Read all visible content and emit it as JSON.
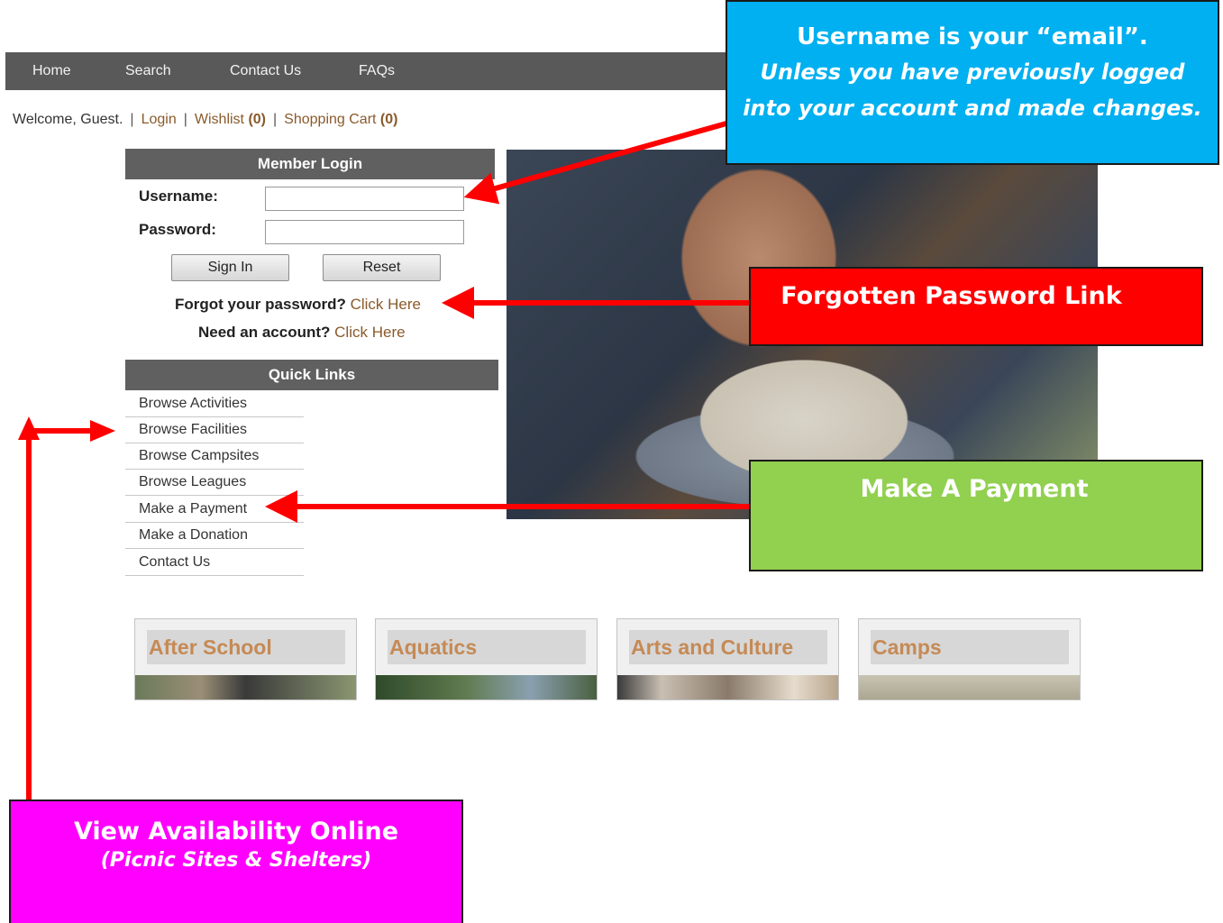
{
  "nav": {
    "items": [
      "Home",
      "Search",
      "Contact Us",
      "FAQs"
    ]
  },
  "welcome": {
    "greeting": "Welcome, Guest.",
    "login": "Login",
    "wishlist": "Wishlist",
    "wishlist_count": "(0)",
    "cart": "Shopping Cart",
    "cart_count": "(0)"
  },
  "login": {
    "header": "Member Login",
    "username_label": "Username:",
    "password_label": "Password:",
    "username_value": "",
    "password_value": "",
    "sign_in": "Sign In",
    "reset": "Reset",
    "forgot_text": "Forgot your password?",
    "forgot_link": "Click Here",
    "account_text": "Need an account?",
    "account_link": "Click Here"
  },
  "quick_links": {
    "header": "Quick Links",
    "items": [
      "Browse Activities",
      "Browse Facilities",
      "Browse Campsites",
      "Browse Leagues",
      "Make a Payment",
      "Make a Donation",
      "Contact Us"
    ]
  },
  "categories": [
    "After School",
    "Aquatics",
    "Arts and Culture",
    "Camps"
  ],
  "callouts": {
    "username": {
      "title": "Username is your “email”.",
      "sub": "Unless you have previously logged into your account and made changes.",
      "color": "#00b0f0"
    },
    "forgot": {
      "title": "Forgotten Password Link",
      "color": "#ff0000"
    },
    "payment": {
      "title": "Make A Payment",
      "color": "#92d050"
    },
    "availability": {
      "title": "View Availability Online",
      "sub": "(Picnic Sites & Shelters)",
      "color": "#ff00ff"
    }
  },
  "arrow_color": "#ff0000"
}
